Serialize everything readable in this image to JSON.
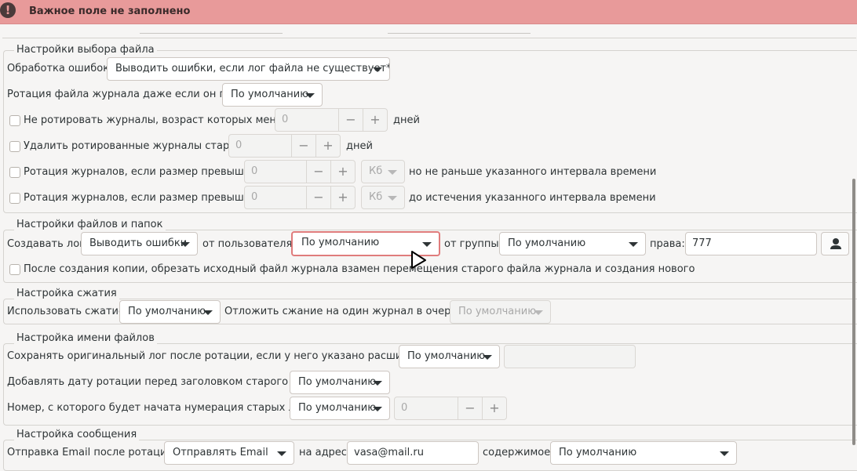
{
  "banner": {
    "icon": "error-icon",
    "icon_glyph": "!",
    "message": "Важное поле не заполнено"
  },
  "file_select": {
    "legend": "Настройки выбора файла",
    "errors_label": "Обработка ошибок:",
    "errors_value": "Выводить ошибки, если лог файла не существует*",
    "rotate_empty_label": "Ротация файла журнала даже если он пуст:",
    "rotate_empty_value": "По умолчанию",
    "min_age_label": "Не ротировать журналы, возраст которых меньше",
    "min_age_value": "0",
    "min_age_unit": "дней",
    "max_age_label": "Удалить ротированные журналы старше",
    "max_age_value": "0",
    "max_age_unit": "дней",
    "minsize_label": "Ротация журналов, если размер превышает",
    "minsize_value": "0",
    "minsize_unit": "Кб",
    "minsize_suffix": "но не раньше указанного интервала времени",
    "maxsize_label": "Ротация журналов, если размер превышает",
    "maxsize_value": "0",
    "maxsize_unit": "Кб",
    "maxsize_suffix": "до истечения указанного интервала времени",
    "minus": "−",
    "plus": "+"
  },
  "files_folders": {
    "legend": "Настройки файлов и папок",
    "create_label": "Создавать лог",
    "create_value": "Выводить ошибки",
    "user_label": "от пользователя:",
    "user_value": "По умолчанию",
    "group_label": "от группы:",
    "group_value": "По умолчанию",
    "perms_label": "права:",
    "perms_value": "777",
    "copytruncate_label": "После создания копии, обрезать исходный файл журнала взамен перемещения старого файла журнала и создания нового"
  },
  "compression": {
    "legend": "Настройка сжатия",
    "use_label": "Использовать сжатие:",
    "use_value": "По умолчанию",
    "delay_label": "Отложить сжание на один журнал в очереди:",
    "delay_value": "По умолчанию"
  },
  "naming": {
    "legend": "Настройка имени файлов",
    "ext_label": "Сохранять оригинальный лог после ротации, если у него указано расширение:",
    "ext_value": "По умолчанию",
    "ext_entry": "",
    "date_label": "Добавлять дату ротации перед заголовком старого лога:",
    "date_value": "По умолчанию",
    "start_label": "Номер, с которого будет начата нумерация старых логов:",
    "start_value": "По умолчанию",
    "start_entry": "0"
  },
  "message": {
    "legend": "Настройка сообщения",
    "email_label": "Отправка Email после ротации:",
    "email_value": "Отправлять Email",
    "address_label": "на адрес:",
    "address_value": "vasa@mail.ru",
    "content_label": "содержимое:",
    "content_value": "По умолчанию"
  }
}
